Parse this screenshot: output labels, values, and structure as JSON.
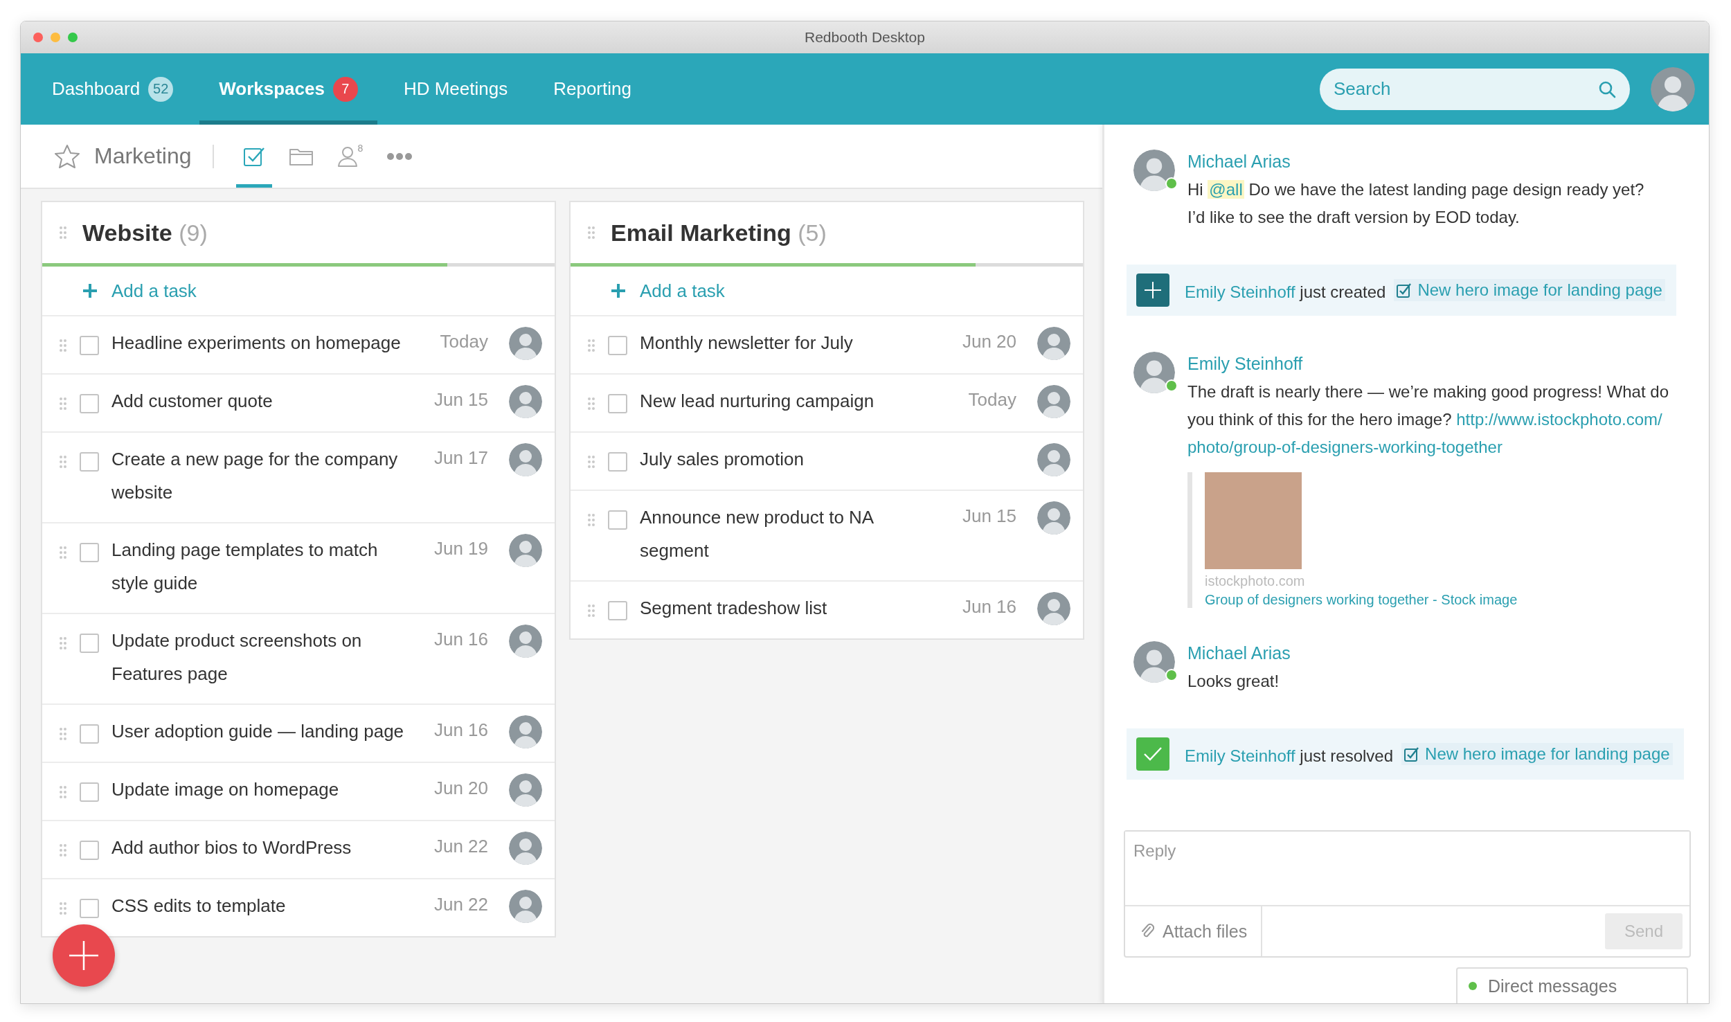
{
  "window": {
    "title": "Redbooth Desktop"
  },
  "nav": {
    "tabs": [
      {
        "label": "Dashboard",
        "selected": false,
        "badge": {
          "text": "52",
          "alert": false
        }
      },
      {
        "label": "Workspaces",
        "selected": true,
        "badge": {
          "text": "7",
          "alert": true
        }
      },
      {
        "label": "HD Meetings",
        "selected": false
      },
      {
        "label": "Reporting",
        "selected": false
      }
    ],
    "search": {
      "placeholder": "Search"
    }
  },
  "toolbar": {
    "title": "Marketing",
    "starred": false,
    "views": [
      {
        "kind": "tasks",
        "selected": true
      },
      {
        "kind": "files",
        "selected": false
      },
      {
        "kind": "people",
        "selected": false,
        "count": "8"
      },
      {
        "kind": "more",
        "selected": false
      }
    ]
  },
  "columns": [
    {
      "title": "Website",
      "count": "(9)",
      "level": 0.79,
      "add_label": "Add a task",
      "tasks": [
        {
          "text": "Headline experiments on homepage",
          "due": "Today",
          "checked": false
        },
        {
          "text": "Add customer quote",
          "due": "Jun 15",
          "checked": false
        },
        {
          "text": "Create a new page for the company website",
          "due": "Jun 17",
          "checked": false
        },
        {
          "text": "Landing page templates to match style guide",
          "due": "Jun 19",
          "checked": false
        },
        {
          "text": "Update product screenshots on Features page",
          "due": "Jun 16",
          "checked": false
        },
        {
          "text": "User adoption guide — landing page",
          "due": "Jun 16",
          "checked": false
        },
        {
          "text": "Update image on homepage",
          "due": "Jun 20",
          "checked": false
        },
        {
          "text": "Add author bios to WordPress",
          "due": "Jun 22",
          "checked": false
        },
        {
          "text": "CSS edits to template",
          "due": "Jun 22",
          "checked": false
        }
      ]
    },
    {
      "title": "Email Marketing",
      "count": "(5)",
      "level": 0.79,
      "add_label": "Add a task",
      "tasks": [
        {
          "text": "Monthly newsletter for July",
          "due": "Jun 20",
          "checked": false
        },
        {
          "text": "New lead nurturing campaign",
          "due": "Today",
          "checked": false
        },
        {
          "text": "July sales promotion",
          "checked": false
        },
        {
          "text": "Announce new product to NA segment",
          "due": "Jun 15",
          "checked": false
        },
        {
          "text": "Segment tradeshow list",
          "due": "Jun 16",
          "checked": false
        }
      ]
    }
  ],
  "chat": {
    "items": [
      {
        "kind": "message",
        "author": "Michael Arias",
        "online": true,
        "before": "Hi",
        "mention": "@all",
        "lines": [
          "Do we have the latest landing page design ready yet?",
          "I’d like to see the draft version by EOD today."
        ]
      },
      {
        "kind": "created",
        "author": "Emily Steinhoff",
        "action": "just created",
        "task": "New hero image for landing page"
      },
      {
        "kind": "message",
        "author": "Emily Steinhoff",
        "online": true,
        "text": "The draft is nearly there — we’re making good progress! What do you think of this for the hero image?",
        "link_lines": [
          "http://www.istockphoto.com/",
          "photo/group-of-designers-working-together"
        ],
        "preview": {
          "source": "istockphoto.com",
          "title": "Group of designers working together - Stock image"
        }
      },
      {
        "kind": "message",
        "author": "Michael Arias",
        "online": true,
        "lines": [
          "Looks great!"
        ]
      },
      {
        "kind": "resolved",
        "author": "Emily Steinhoff",
        "action": "just resolved",
        "task": "New hero image for landing page"
      }
    ],
    "reply": {
      "placeholder": "Reply",
      "attach_label": "Attach files",
      "send_label": "Send",
      "send_disabled": true
    },
    "direct_messages": {
      "label": "Direct messages",
      "online": true
    }
  }
}
